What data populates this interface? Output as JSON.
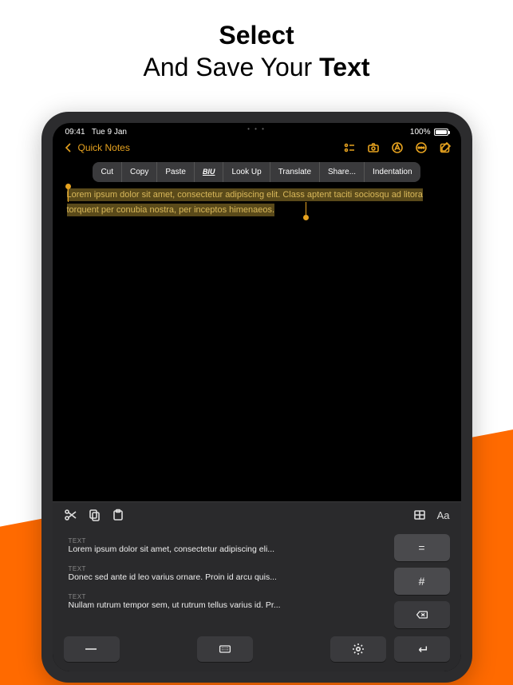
{
  "hero": {
    "line1": "Select",
    "line2_prefix": "And Save Your ",
    "line2_bold": "Text"
  },
  "status": {
    "time": "09:41",
    "date": "Tue 9 Jan",
    "battery": "100%"
  },
  "appbar": {
    "back_label": "Quick Notes"
  },
  "context_menu": {
    "cut": "Cut",
    "copy": "Copy",
    "paste": "Paste",
    "biu": "BIU",
    "lookup": "Look Up",
    "translate": "Translate",
    "share": "Share...",
    "indentation": "Indentation"
  },
  "note": {
    "selected": "Lorem ipsum dolor sit amet, consectetur adipiscing elit. Class aptent taciti sociosqu ad litora torquent per conubia nostra, per inceptos himenaeos."
  },
  "keyboard": {
    "aa": "Aa",
    "snippets": [
      {
        "label": "TEXT",
        "text": "Lorem ipsum dolor sit amet, consectetur adipiscing eli..."
      },
      {
        "label": "TEXT",
        "text": "Donec sed ante id leo varius ornare. Proin id arcu quis..."
      },
      {
        "label": "TEXT",
        "text": "Nullam rutrum tempor sem, ut rutrum tellus varius id. Pr..."
      }
    ],
    "keys": {
      "equals": "=",
      "hash": "#"
    }
  }
}
